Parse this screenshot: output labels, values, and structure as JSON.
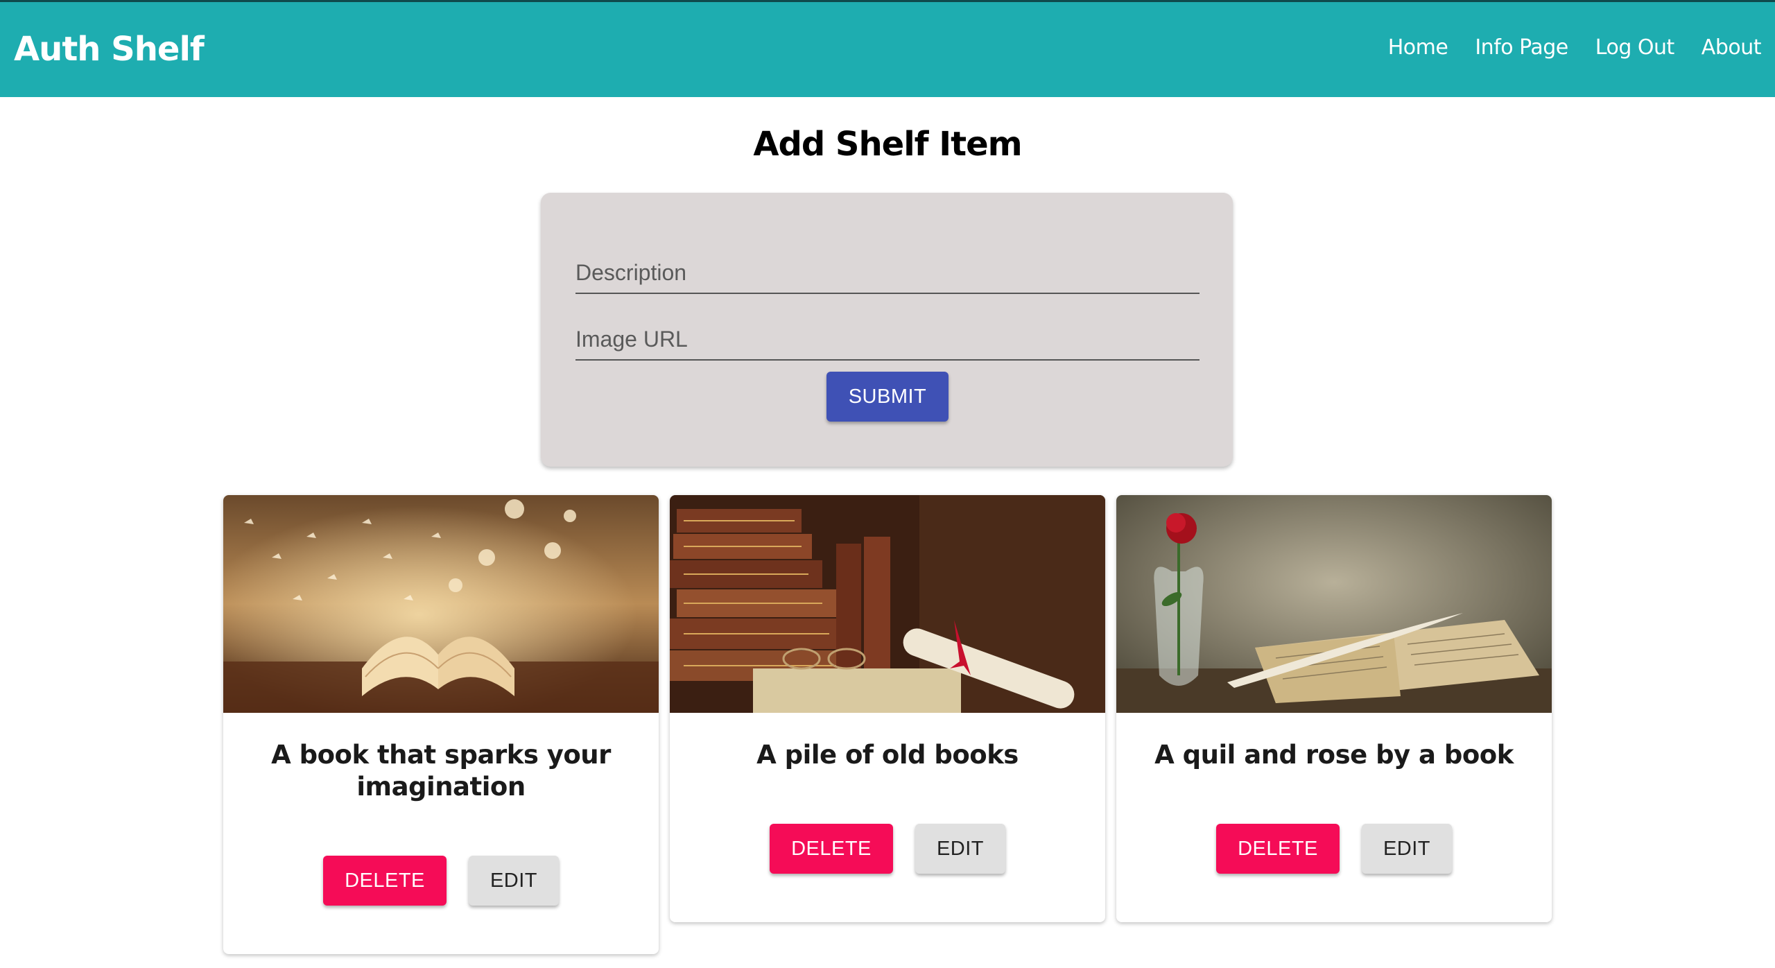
{
  "app": {
    "brand": "Auth Shelf"
  },
  "nav": {
    "items": [
      {
        "label": "Home"
      },
      {
        "label": "Info Page"
      },
      {
        "label": "Log Out"
      },
      {
        "label": "About"
      }
    ]
  },
  "form": {
    "title": "Add Shelf Item",
    "description_placeholder": "Description",
    "description_value": "",
    "image_url_placeholder": "Image URL",
    "image_url_value": "",
    "submit_label": "SUBMIT"
  },
  "shelf": {
    "items": [
      {
        "description": "A book that sparks your imagination",
        "image": "open-book-with-butterflies",
        "delete_label": "DELETE",
        "edit_label": "EDIT"
      },
      {
        "description": "A pile of old books",
        "image": "stack-of-old-books-with-scroll",
        "delete_label": "DELETE",
        "edit_label": "EDIT"
      },
      {
        "description": "A quil and rose by a book",
        "image": "rose-in-vase-with-quill-and-book",
        "delete_label": "DELETE",
        "edit_label": "EDIT"
      }
    ]
  },
  "colors": {
    "navbar": "#1eadb0",
    "submit": "#3f51b5",
    "delete": "#f50c57",
    "edit": "#e0e0e0",
    "form_card": "#dcd7d7"
  }
}
